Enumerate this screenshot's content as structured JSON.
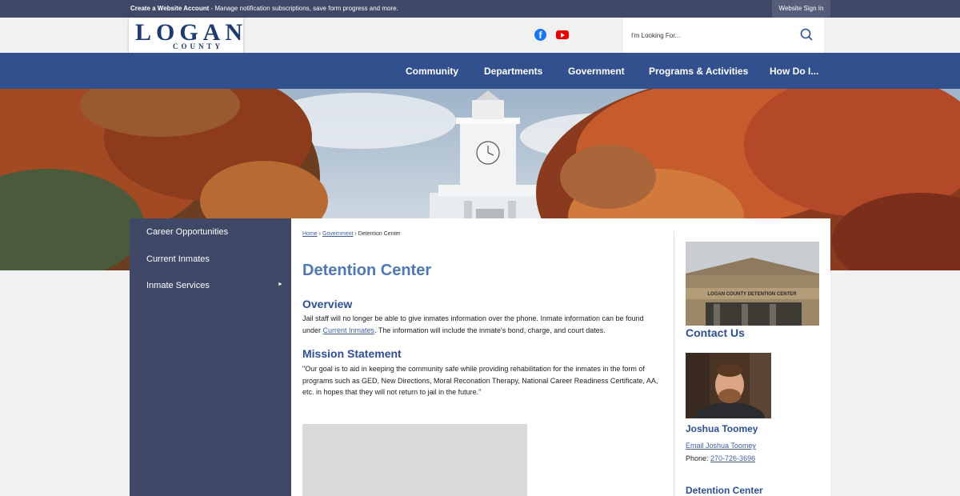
{
  "topbar": {
    "create_account": "Create a Website Account",
    "create_account_rest": " - Manage notification subscriptions, save form progress and more.",
    "sign_in": "Website Sign In"
  },
  "header": {
    "logo_word": "LOGAN",
    "logo_sub": "COUNTY",
    "social": [
      "facebook-icon",
      "youtube-icon"
    ],
    "search_placeholder": "I'm Looking For..."
  },
  "nav": [
    "Community",
    "Departments",
    "Government",
    "Programs & Activities",
    "How Do I..."
  ],
  "sidebar": {
    "items": [
      "Career Opportunities",
      "Current Inmates",
      "Inmate Services"
    ],
    "submenu_arrow": "►"
  },
  "breadcrumb": {
    "home": "Home",
    "sep": "›",
    "government": "Government",
    "current": "Detention Center"
  },
  "page": {
    "title": "Detention Center",
    "overview_heading": "Overview",
    "overview_text_1": "Jail staff will no longer be able to give inmates information over the phone. Inmate information can be found under ",
    "overview_link": "Current Inmates",
    "overview_text_2": ". The information will include the inmate's bond, charge, and court dates.",
    "mission_heading": "Mission Statement",
    "mission_text": "\"Our goal is to aid in keeping the community safe while providing rehabilitation for the inmates in the form of programs such as GED, New Directions, Moral Reconation Therapy, National Career Readiness Certificate, AA, etc. in hopes that they will not return to jail in the future.\""
  },
  "contact": {
    "building_sign": "LOGAN COUNTY DETENTION CENTER",
    "heading": "Contact Us",
    "name": "Joshua Toomey",
    "email_label": "Email Joshua Toomey",
    "phone_label": "Phone: ",
    "phone": "270-726-3696",
    "next_heading": "Detention Center"
  },
  "colors": {
    "nav_bg": "#33508e",
    "sidebar_bg": "#3f4867",
    "heading": "#2d4f94",
    "title": "#4f78b4"
  }
}
